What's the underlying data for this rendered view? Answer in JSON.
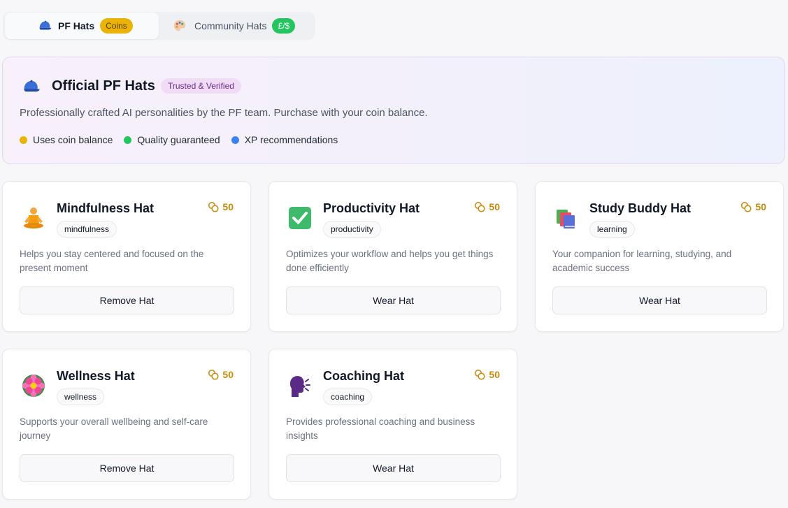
{
  "tabs": [
    {
      "label": "PF Hats",
      "badge": "Coins",
      "icon": "blue-cap-icon",
      "active": true
    },
    {
      "label": "Community Hats",
      "badge": "£/$",
      "icon": "palette-icon",
      "active": false
    }
  ],
  "banner": {
    "icon": "blue-cap-icon",
    "title": "Official PF Hats",
    "badge": "Trusted & Verified",
    "description": "Professionally crafted AI personalities by the PF team. Purchase with your coin balance.",
    "features": [
      {
        "label": "Uses coin balance",
        "color": "#eab308"
      },
      {
        "label": "Quality guaranteed",
        "color": "#22c55e"
      },
      {
        "label": "XP recommendations",
        "color": "#3b82f6"
      }
    ]
  },
  "cards": [
    {
      "title": "Mindfulness Hat",
      "tag": "mindfulness",
      "price": "50",
      "icon": "meditation-icon",
      "description": "Helps you stay centered and focused on the present moment",
      "button": "Remove Hat"
    },
    {
      "title": "Productivity Hat",
      "tag": "productivity",
      "price": "50",
      "icon": "checkmark-box-icon",
      "description": "Optimizes your workflow and helps you get things done efficiently",
      "button": "Wear Hat"
    },
    {
      "title": "Study Buddy Hat",
      "tag": "learning",
      "price": "50",
      "icon": "books-icon",
      "description": "Your companion for learning, studying, and academic success",
      "button": "Wear Hat"
    },
    {
      "title": "Wellness Hat",
      "tag": "wellness",
      "price": "50",
      "icon": "lotus-icon",
      "description": "Supports your overall wellbeing and self-care journey",
      "button": "Remove Hat"
    },
    {
      "title": "Coaching Hat",
      "tag": "coaching",
      "price": "50",
      "icon": "speaking-head-icon",
      "description": "Provides professional coaching and business insights",
      "button": "Wear Hat"
    }
  ],
  "colors": {
    "accent_gold": "#c98a0a",
    "coins_badge": "#eab308",
    "money_badge": "#22c55e"
  }
}
